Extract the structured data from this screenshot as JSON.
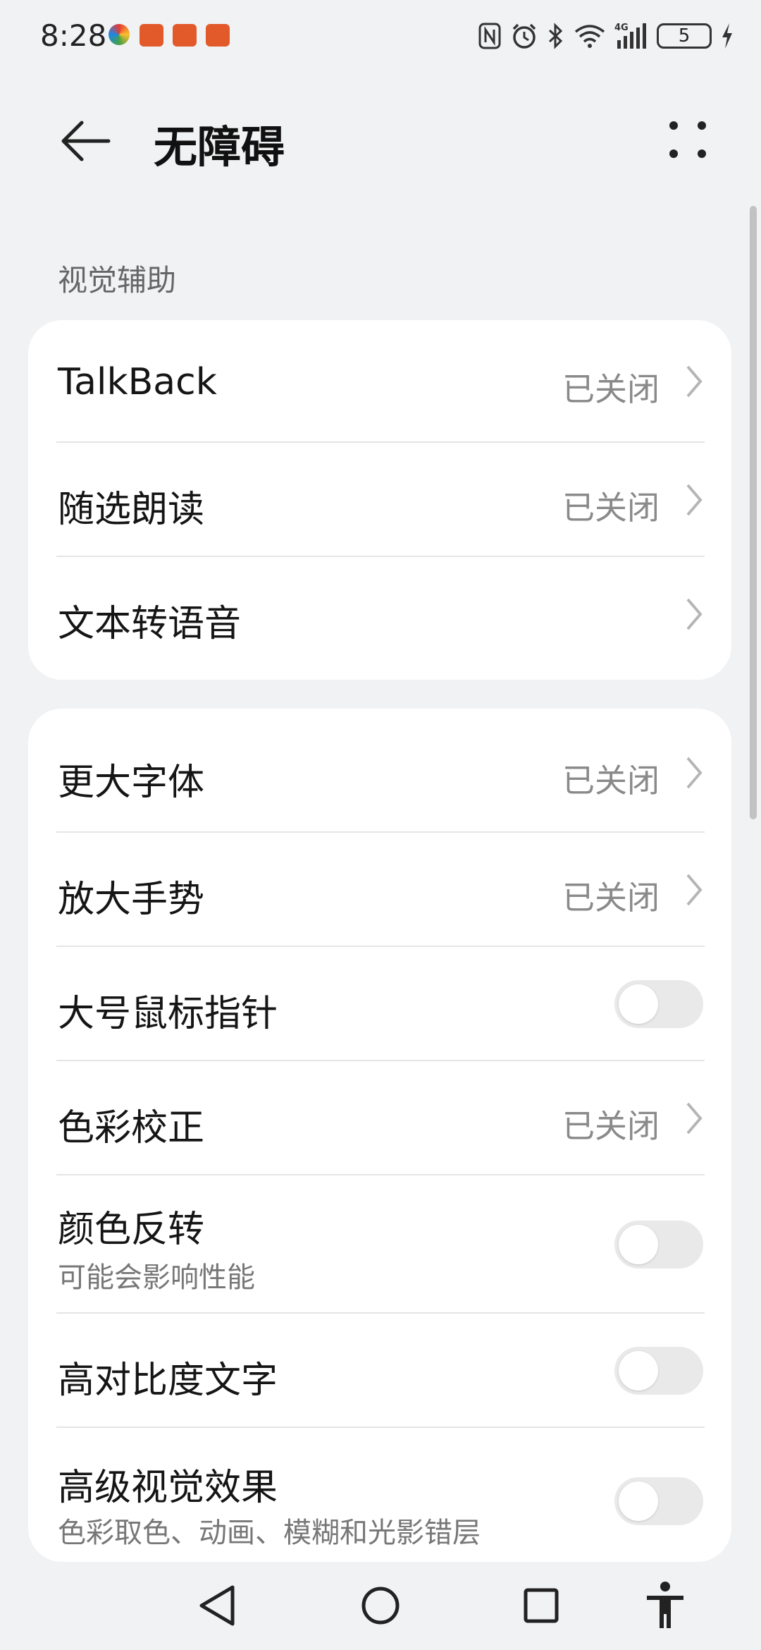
{
  "status_bar": {
    "time": "8:28",
    "battery": "5",
    "icons": [
      "nfc-icon",
      "alarm-icon",
      "bluetooth-icon",
      "wifi-icon",
      "signal-4g-icon",
      "battery-icon",
      "charging-icon"
    ]
  },
  "header": {
    "title": "无障碍",
    "back_icon": "arrow-left-icon",
    "more_icon": "more-icon"
  },
  "section_label": "视觉辅助",
  "card1": [
    {
      "title": "TalkBack",
      "value": "已关闭",
      "control": "chevron"
    },
    {
      "title": "随选朗读",
      "value": "已关闭",
      "control": "chevron"
    },
    {
      "title": "文本转语音",
      "value": "",
      "control": "chevron"
    }
  ],
  "card2": [
    {
      "title": "更大字体",
      "value": "已关闭",
      "control": "chevron"
    },
    {
      "title": "放大手势",
      "value": "已关闭",
      "control": "chevron"
    },
    {
      "title": "大号鼠标指针",
      "control": "toggle",
      "on": false
    },
    {
      "title": "色彩校正",
      "value": "已关闭",
      "control": "chevron"
    },
    {
      "title": "颜色反转",
      "subtitle": "可能会影响性能",
      "control": "toggle",
      "on": false
    },
    {
      "title": "高对比度文字",
      "control": "toggle",
      "on": false
    },
    {
      "title": "高级视觉效果",
      "subtitle": "色彩取色、动画、模糊和光影错层",
      "control": "toggle",
      "on": false
    }
  ],
  "nav": {
    "icons": [
      "back-triangle-icon",
      "home-circle-icon",
      "recents-square-icon",
      "accessibility-icon"
    ]
  },
  "colors": {
    "background": "#f1f2f4",
    "card": "#ffffff",
    "toggle_off": "#e9e9e9"
  }
}
